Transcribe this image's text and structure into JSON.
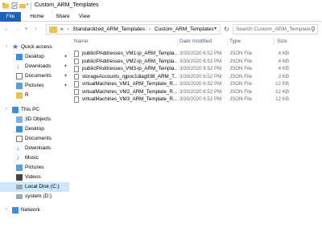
{
  "window": {
    "title": "Custom_ARM_Templates"
  },
  "ribbon": {
    "tabs": [
      {
        "label": "File"
      },
      {
        "label": "Home"
      },
      {
        "label": "Share"
      },
      {
        "label": "View"
      }
    ]
  },
  "address": {
    "prefix": "«",
    "segments": [
      "Standardized_ARM_Templates",
      "Custom_ARM_Templates"
    ],
    "separator": "›"
  },
  "search": {
    "placeholder": "Search Custom_ARM_Template..."
  },
  "sidebar": {
    "quick_access": "Quick access",
    "quick_items": [
      {
        "label": "Desktop",
        "icon": "desktop-icon"
      },
      {
        "label": "Downloads",
        "icon": "downloads-icon"
      },
      {
        "label": "Documents",
        "icon": "documents-icon"
      },
      {
        "label": "Pictures",
        "icon": "pictures-icon"
      },
      {
        "label": "R",
        "icon": "folder-icon"
      }
    ],
    "this_pc": "This PC",
    "pc_items": [
      {
        "label": "3D Objects",
        "icon": "3d-objects-icon"
      },
      {
        "label": "Desktop",
        "icon": "desktop-icon"
      },
      {
        "label": "Documents",
        "icon": "documents-icon"
      },
      {
        "label": "Downloads",
        "icon": "downloads-icon"
      },
      {
        "label": "Music",
        "icon": "music-icon"
      },
      {
        "label": "Pictures",
        "icon": "pictures-icon"
      },
      {
        "label": "Videos",
        "icon": "videos-icon"
      },
      {
        "label": "Local Disk (C:)",
        "icon": "local-disk-icon"
      },
      {
        "label": "system (D:)",
        "icon": "drive-icon"
      }
    ],
    "network": "Network"
  },
  "columns": {
    "name": "Name",
    "date": "Date modified",
    "type": "Type",
    "size": "Size"
  },
  "files": [
    {
      "name": "publicIPAddresses_VM1-ip_ARM_Templa...",
      "date": "3/30/2020 6:52 PM",
      "type": "JSON File",
      "size": "4 KB"
    },
    {
      "name": "publicIPAddresses_VM2-ip_ARM_Templa...",
      "date": "3/30/2020 6:52 PM",
      "type": "JSON File",
      "size": "4 KB"
    },
    {
      "name": "publicIPAddresses_VM3-ip_ARM_Templa...",
      "date": "3/30/2020 6:52 PM",
      "type": "JSON File",
      "size": "4 KB"
    },
    {
      "name": "storageAccounts_rgpoc1diag938_ARM_T...",
      "date": "3/30/2020 6:52 PM",
      "type": "JSON File",
      "size": "3 KB"
    },
    {
      "name": "virtualMachines_VM1_ARM_Template_R...",
      "date": "3/30/2020 6:52 PM",
      "type": "JSON File",
      "size": "12 KB"
    },
    {
      "name": "virtualMachines_VM2_ARM_Template_R...",
      "date": "3/30/2020 6:52 PM",
      "type": "JSON File",
      "size": "12 KB"
    },
    {
      "name": "virtualMachines_VM3_ARM_Template_R...",
      "date": "3/30/2020 6:52 PM",
      "type": "JSON File",
      "size": "12 KB"
    }
  ],
  "colors": {
    "file_tab": "#1b62b8",
    "selected": "#cce8ff",
    "folder": "#e8c255",
    "header_text": "#4c607a"
  }
}
